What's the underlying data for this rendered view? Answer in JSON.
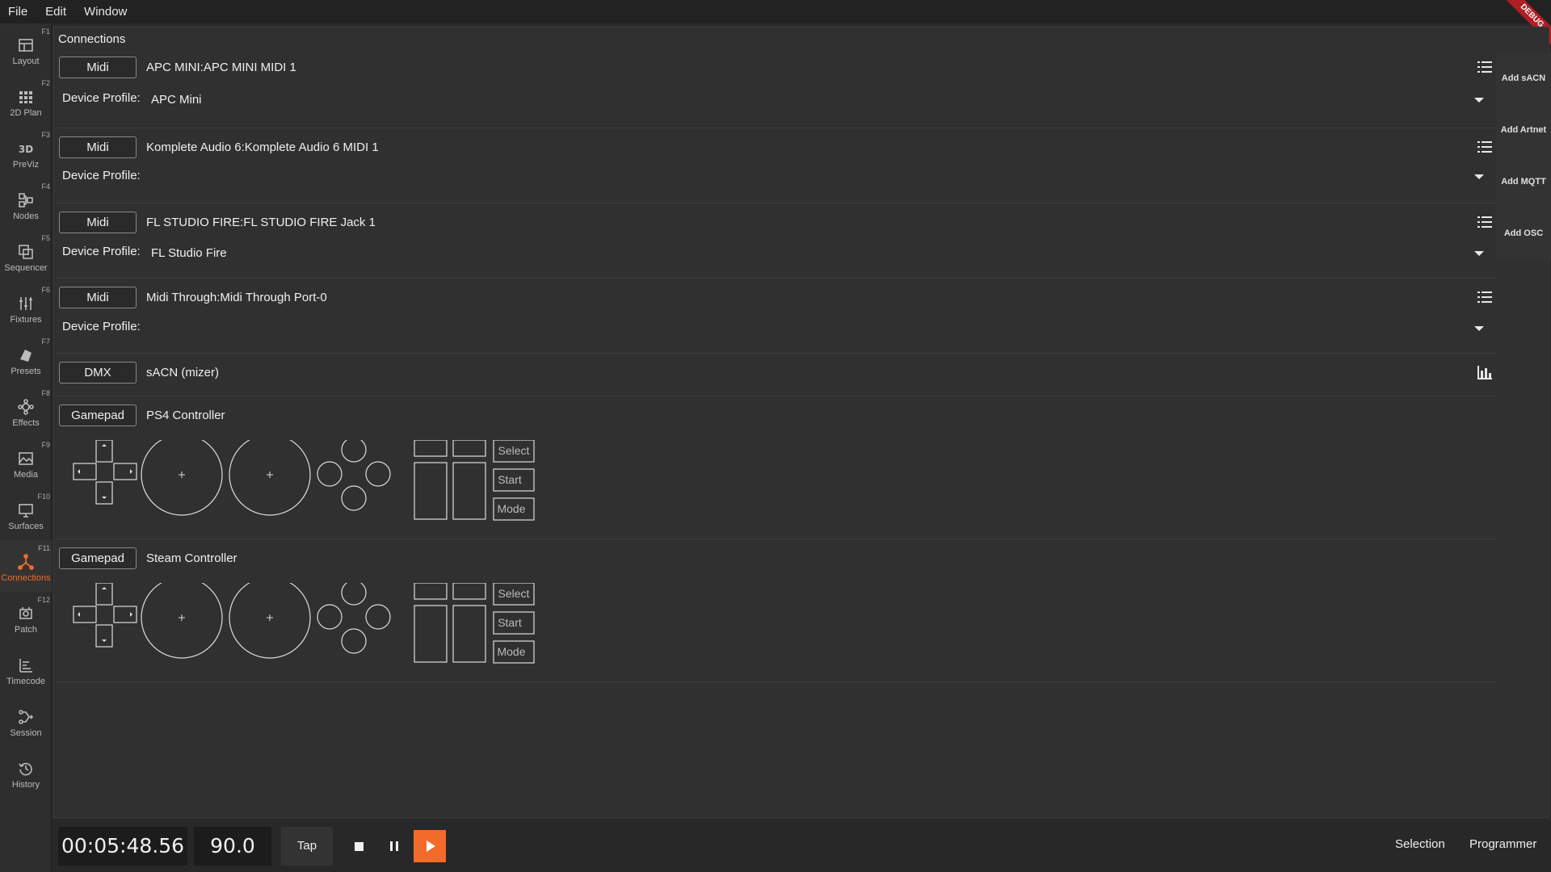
{
  "menu": {
    "items": [
      "File",
      "Edit",
      "Window"
    ]
  },
  "debug_badge": "DEBUG",
  "sidebar": {
    "items": [
      {
        "label": "Layout",
        "fkey": "F1",
        "icon": "layout-icon"
      },
      {
        "label": "2D Plan",
        "fkey": "F2",
        "icon": "grid-icon"
      },
      {
        "label": "PreViz",
        "fkey": "F3",
        "icon": "3d-icon"
      },
      {
        "label": "Nodes",
        "fkey": "F4",
        "icon": "nodes-icon"
      },
      {
        "label": "Sequencer",
        "fkey": "F5",
        "icon": "sequencer-icon"
      },
      {
        "label": "Fixtures",
        "fkey": "F6",
        "icon": "sliders-icon"
      },
      {
        "label": "Presets",
        "fkey": "F7",
        "icon": "presets-icon"
      },
      {
        "label": "Effects",
        "fkey": "F8",
        "icon": "effects-icon"
      },
      {
        "label": "Media",
        "fkey": "F9",
        "icon": "media-icon"
      },
      {
        "label": "Surfaces",
        "fkey": "F10",
        "icon": "monitor-icon"
      },
      {
        "label": "Connections",
        "fkey": "F11",
        "icon": "connections-icon",
        "active": true
      },
      {
        "label": "Patch",
        "fkey": "F12",
        "icon": "patch-icon"
      },
      {
        "label": "Timecode",
        "fkey": "",
        "icon": "timecode-icon"
      },
      {
        "label": "Session",
        "fkey": "",
        "icon": "session-icon"
      },
      {
        "label": "History",
        "fkey": "",
        "icon": "history-icon"
      }
    ]
  },
  "panel": {
    "title": "Connections"
  },
  "connections": [
    {
      "type": "Midi",
      "name": "APC MINI:APC MINI MIDI 1",
      "profile_label": "Device Profile:",
      "profile": "APC Mini"
    },
    {
      "type": "Midi",
      "name": "Komplete Audio 6:Komplete Audio 6 MIDI 1",
      "profile_label": "Device Profile:",
      "profile": ""
    },
    {
      "type": "Midi",
      "name": "FL STUDIO FIRE:FL STUDIO FIRE Jack 1",
      "profile_label": "Device Profile:",
      "profile": "FL Studio Fire"
    },
    {
      "type": "Midi",
      "name": "Midi Through:Midi Through Port-0",
      "profile_label": "Device Profile:",
      "profile": ""
    },
    {
      "type": "DMX",
      "name": "sACN (mizer)"
    },
    {
      "type": "Gamepad",
      "name": "PS4 Controller",
      "buttons": [
        "Select",
        "Start",
        "Mode"
      ]
    },
    {
      "type": "Gamepad",
      "name": "Steam Controller",
      "buttons": [
        "Select",
        "Start",
        "Mode"
      ]
    }
  ],
  "right_actions": [
    "Add sACN",
    "Add Artnet",
    "Add MQTT",
    "Add OSC"
  ],
  "transport": {
    "timecode": "00:05:48.56",
    "bpm": "90.0",
    "tap_label": "Tap",
    "selection_label": "Selection",
    "programmer_label": "Programmer",
    "accent": "#f26b2b"
  }
}
